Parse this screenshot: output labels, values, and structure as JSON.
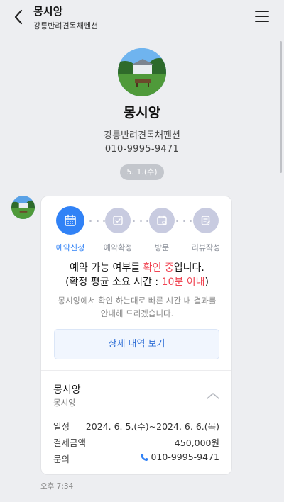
{
  "header": {
    "title": "몽시앙",
    "subtitle": "강릉반려견독채펜션"
  },
  "profile": {
    "name": "몽시앙",
    "category": "강릉반려견독채펜션",
    "phone": "010-9995-9471"
  },
  "date_pill": "5. 1.(수)",
  "steps": [
    {
      "label": "예약신청",
      "icon": "calendar-icon",
      "active": true
    },
    {
      "label": "예약확정",
      "icon": "check-square-icon",
      "active": false
    },
    {
      "label": "방문",
      "icon": "calendar-visit-icon",
      "active": false
    },
    {
      "label": "리뷰작성",
      "icon": "edit-note-icon",
      "active": false
    }
  ],
  "message": {
    "line1_prefix": "예약 가능 여부를 ",
    "line1_highlight": "확인 중",
    "line1_suffix": "입니다.",
    "line2_prefix": "(확정 평균 소요 시간 : ",
    "line2_highlight": "10분 이내",
    "line2_suffix": ")",
    "sub_line1": "몽시앙에서 확인 하는대로 빠른 시간 내 결과를",
    "sub_line2": "안내해 드리겠습니다."
  },
  "detail_button": "상세 내역 보기",
  "info": {
    "title": "몽시앙",
    "subtitle": "몽시앙",
    "rows": [
      {
        "label": "일정",
        "value": "2024. 6. 5.(수)~2024. 6. 6.(목)"
      },
      {
        "label": "결제금액",
        "value": "450,000원"
      },
      {
        "label": "문의",
        "value": "010-9995-9471"
      }
    ]
  },
  "timestamp": "오후 7:34",
  "colors": {
    "accent": "#3182f6",
    "highlight_red": "#f04452",
    "background": "#edeef1"
  }
}
